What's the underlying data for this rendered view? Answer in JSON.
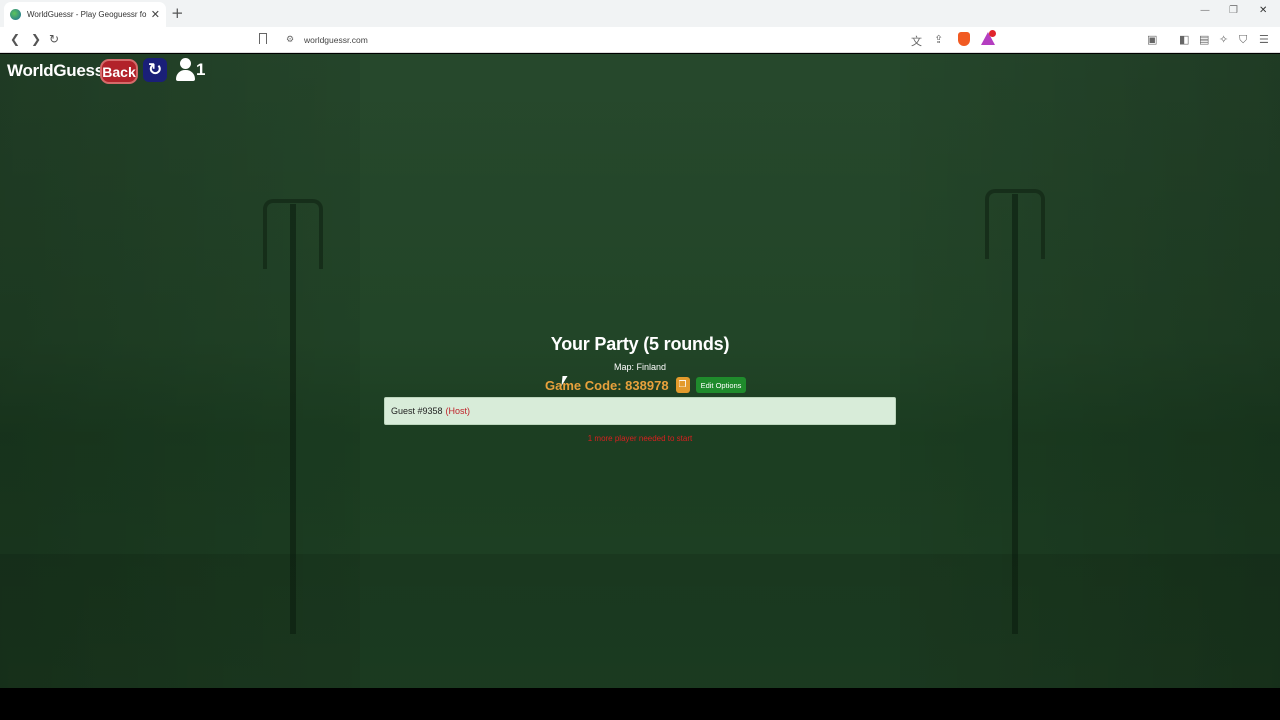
{
  "browser": {
    "tab_title": "WorldGuessr - Play Geoguessr fo",
    "tab_close": "✕",
    "new_tab": "+",
    "url": "worldguessr.com",
    "window_controls": [
      "—",
      "❐",
      "✕"
    ]
  },
  "header": {
    "brand": "WorldGuessr",
    "back_label": "Back",
    "refresh_icon": "↻",
    "player_count": "1"
  },
  "party": {
    "title": "Your Party (5 rounds)",
    "map_line": "Map: Finland",
    "game_code": "Game Code: 838978",
    "edit_label": "Edit Options",
    "players": [
      {
        "name": "Guest #9358",
        "tag": "(Host)"
      }
    ],
    "need_message": "1 more player needed to start"
  },
  "colors": {
    "overlay": "#123a1a",
    "back_button": "#b2222a",
    "refresh_button": "#1a1f78",
    "game_code": "#e8a13c",
    "edit_button": "#1f8b2c",
    "panel_bg": "#d8ecd9",
    "host_tag": "#c0222a",
    "warning": "#d82020"
  }
}
